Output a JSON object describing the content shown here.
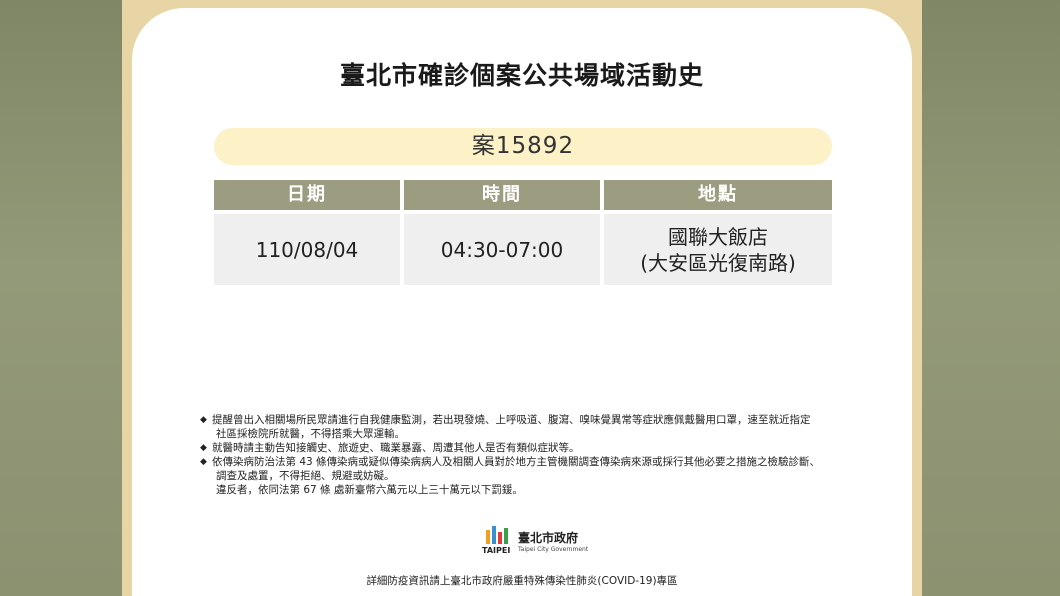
{
  "title": "臺北市確診個案公共場域活動史",
  "case_label": "案15892",
  "table": {
    "headers": [
      "日期",
      "時間",
      "地點"
    ],
    "row": {
      "date": "110/08/04",
      "time": "04:30-07:00",
      "place_line1": "國聯大飯店",
      "place_line2": "(大安區光復南路)"
    }
  },
  "notes": [
    "提醒曾出入相關場所民眾請進行自我健康監測，若出現發燒、上呼吸道、腹瀉、嗅味覺異常等症狀應佩戴醫用口罩，速至就近指定",
    "社區採檢院所就醫，不得搭乘大眾運輸。",
    "就醫時請主動告知接觸史、旅遊史、職業暴露、周遭其他人是否有類似症狀等。",
    "依傳染病防治法第 43 條傳染病或疑似傳染病病人及相關人員對於地方主管機關調查傳染病來源或採行其他必要之措施之檢驗診斷、",
    "調查及處置，不得拒絕、規避或妨礙。",
    "違反者，依同法第 67 條 處新臺幣六萬元以上三十萬元以下罰鍰。"
  ],
  "logo": {
    "name_zh": "臺北市政府",
    "name_en": "Taipei City Government",
    "mark_text": "TAIPEI"
  },
  "footer": "詳細防疫資訊請上臺北市政府嚴重特殊傳染性肺炎(COVID-19)專區",
  "colors": {
    "frame": "#e7d5a5",
    "pill": "#fdf1c7",
    "header_cell": "#9c9d80",
    "body_cell": "#efefef"
  }
}
